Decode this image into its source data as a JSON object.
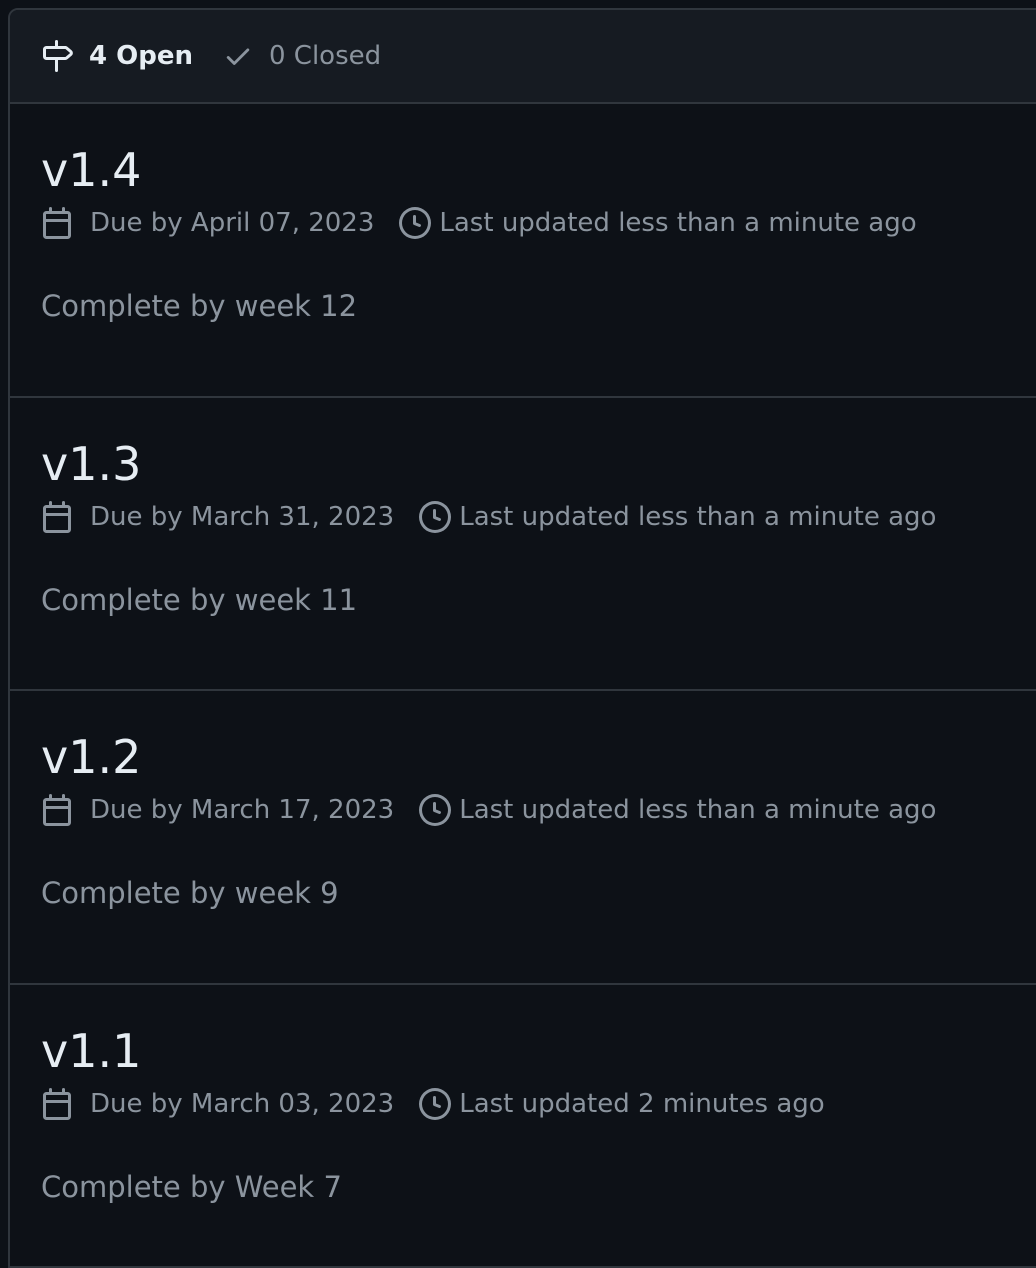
{
  "header": {
    "open_label": "4 Open",
    "closed_label": "0 Closed",
    "open_icon": "milestone-icon",
    "closed_icon": "check-icon"
  },
  "milestones": [
    {
      "title": "v1.4",
      "due": "Due by April 07, 2023",
      "updated": "Last updated less than a minute ago",
      "description": "Complete by week 12"
    },
    {
      "title": "v1.3",
      "due": "Due by March 31, 2023",
      "updated": "Last updated less than a minute ago",
      "description": "Complete by week 11"
    },
    {
      "title": "v1.2",
      "due": "Due by March 17, 2023",
      "updated": "Last updated less than a minute ago",
      "description": "Complete by week 9"
    },
    {
      "title": "v1.1",
      "due": "Due by March 03, 2023",
      "updated": "Last updated 2 minutes ago",
      "description": "Complete by Week 7"
    }
  ],
  "colors": {
    "background": "#0d1117",
    "header_background": "#161b22",
    "border": "#30363d",
    "text_primary": "#e6edf3",
    "text_muted": "#8b949e"
  }
}
